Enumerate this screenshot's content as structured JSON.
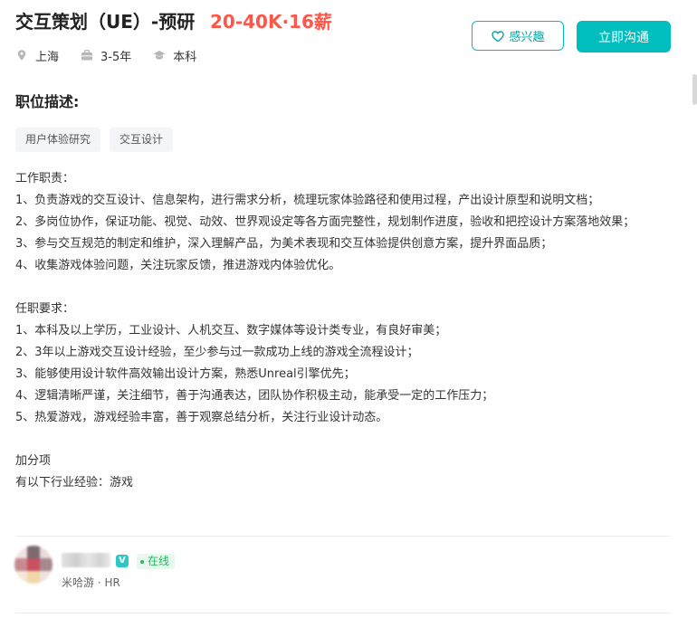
{
  "job": {
    "title": "交互策划（UE）-预研",
    "salary": "20-40K·16薪",
    "location": "上海",
    "experience": "3-5年",
    "education": "本科"
  },
  "actions": {
    "interest_label": "感兴趣",
    "chat_label": "立即沟通"
  },
  "description": {
    "section_title": "职位描述:",
    "tags": [
      "用户体验研究",
      "交互设计"
    ],
    "responsibilities_heading": "工作职责：",
    "responsibilities": [
      "1、负责游戏的交互设计、信息架构，进行需求分析，梳理玩家体验路径和使用过程，产出设计原型和说明文档；",
      "2、多岗位协作，保证功能、视觉、动效、世界观设定等各方面完整性，规划制作进度，验收和把控设计方案落地效果；",
      "3、参与交互规范的制定和维护，深入理解产品，为美术表现和交互体验提供创意方案，提升界面品质；",
      "4、收集游戏体验问题，关注玩家反馈，推进游戏内体验优化。"
    ],
    "requirements_heading": "任职要求：",
    "requirements": [
      "1、本科及以上学历，工业设计、人机交互、数字媒体等设计类专业，有良好审美；",
      "2、3年以上游戏交互设计经验，至少参与过一款成功上线的游戏全流程设计；",
      "3、能够使用设计软件高效输出设计方案，熟悉Unreal引擎优先；",
      "4、逻辑清晰严谨，关注细节，善于沟通表达，团队协作积极主动，能承受一定的工作压力；",
      "5、热爱游戏，游戏经验丰富，善于观察总结分析，关注行业设计动态。"
    ],
    "bonus_heading": "加分项",
    "bonus_text": "有以下行业经验：游戏"
  },
  "recruiter": {
    "verified_mark": "V",
    "online_status": "在线",
    "company_role": "米哈游 · HR"
  },
  "colors": {
    "accent": "#00bebd",
    "salary": "#fe574a",
    "online": "#25b862"
  }
}
